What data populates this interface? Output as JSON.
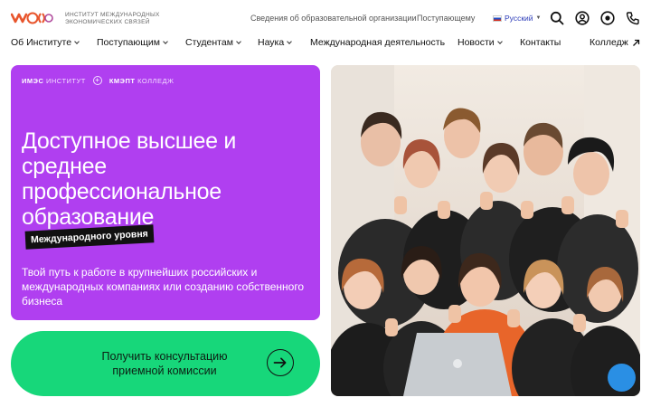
{
  "header": {
    "logo_text": "ИНСТИТУТ МЕЖДУНАРОДНЫХ ЭКОНОМИЧЕСКИХ СВЯЗЕЙ",
    "links": [
      "Сведения об образовательной организации",
      "Поступающему"
    ],
    "language": "Русский",
    "icons": [
      "search-icon",
      "account-icon",
      "accessibility-eye-icon",
      "phone-icon"
    ]
  },
  "nav": {
    "items": [
      {
        "label": "Об Институте",
        "dropdown": true
      },
      {
        "label": "Поступающим",
        "dropdown": true
      },
      {
        "label": "Студентам",
        "dropdown": true
      },
      {
        "label": "Наука",
        "dropdown": true
      },
      {
        "label": "Международная деятельность",
        "dropdown": false
      },
      {
        "label": "Новости",
        "dropdown": true
      },
      {
        "label": "Контакты",
        "dropdown": false
      },
      {
        "label": "Колледж",
        "dropdown": false,
        "external": true
      }
    ]
  },
  "hero": {
    "brand_1_bold": "ИМЭС",
    "brand_1_rest": "ИНСТИТУТ",
    "brand_2_bold": "КМЭПТ",
    "brand_2_rest": "КОЛЛЕДЖ",
    "title": "Доступное высшее и среднее профессиональное образование",
    "badge": "Международного уровня",
    "subtitle": "Твой путь к работе в крупнейших российских и международных компаниях или созданию собственного бизнеса",
    "bg_color": "#b03ff0"
  },
  "cta": {
    "label": "Получить консультацию приемной комиссии",
    "bg_color": "#17d77a"
  },
  "photo": {
    "alt_icon": "group-students-photo",
    "chat_icon": "chat-widget-icon"
  }
}
